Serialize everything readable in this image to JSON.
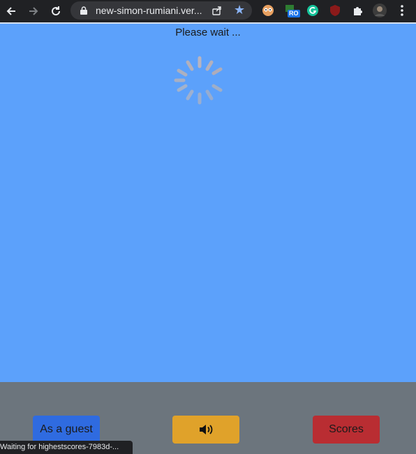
{
  "browser": {
    "url": "new-simon-rumiani.ver...",
    "extension_badge": "RO",
    "status_text": "Waiting for highestscores-7983d-..."
  },
  "page": {
    "loading_text": "Please wait ..."
  },
  "footer": {
    "guest_label": "As a guest",
    "sound_icon": "speaker-icon",
    "scores_label": "Scores"
  },
  "colors": {
    "page_background": "#5ca1fb",
    "footer_background": "#6c757d",
    "guest_button": "#2f6be0",
    "sound_button": "#e0a22a",
    "scores_button": "#b92d32"
  }
}
